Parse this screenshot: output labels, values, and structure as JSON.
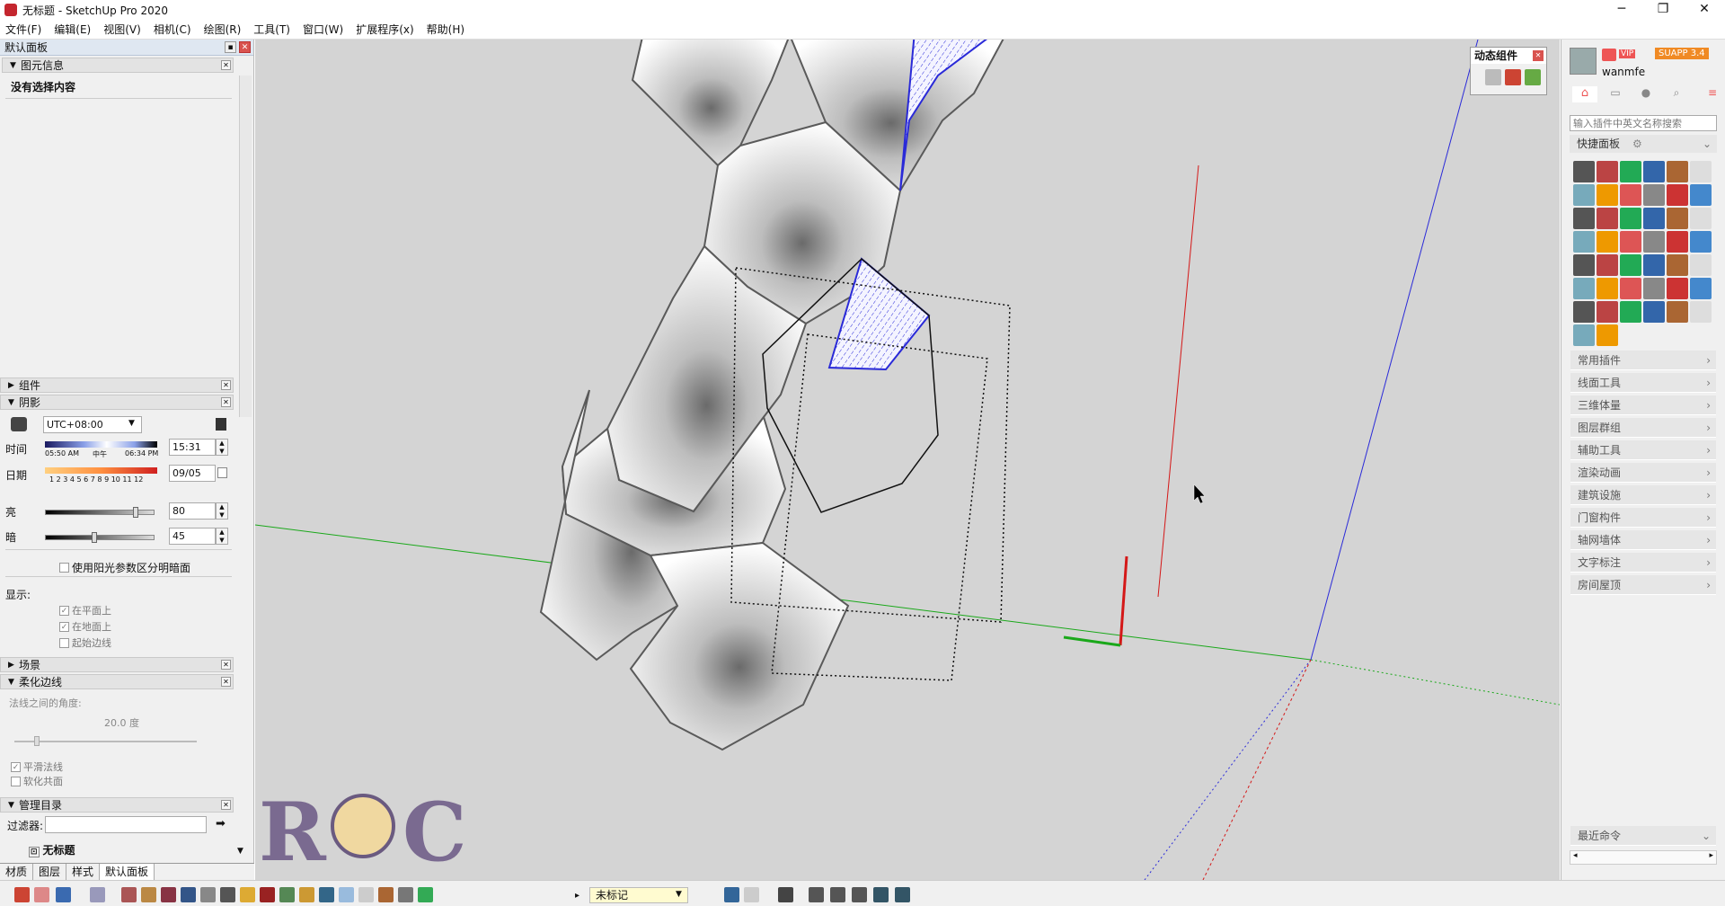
{
  "window": {
    "title": "无标题 - SketchUp Pro 2020",
    "minimize": "─",
    "maximize": "❐",
    "close": "✕"
  },
  "menu": [
    "文件(F)",
    "编辑(E)",
    "视图(V)",
    "相机(C)",
    "绘图(R)",
    "工具(T)",
    "窗口(W)",
    "扩展程序(x)",
    "帮助(H)"
  ],
  "tray": {
    "title": "默认面板"
  },
  "entity_info": {
    "title": "图元信息",
    "empty": "没有选择内容"
  },
  "components": {
    "title": "组件"
  },
  "shadows": {
    "title": "阴影",
    "timezone": "UTC+08:00",
    "time_label": "时间",
    "sunrise": "05:50 AM",
    "noon": "中午",
    "sunset": "06:34 PM",
    "time_value": "15:31",
    "date_label": "日期",
    "months": "1 2 3 4 5 6 7 8 9 10 11 12",
    "date_value": "09/05",
    "light_label": "亮",
    "light_value": "80",
    "dark_label": "暗",
    "dark_value": "45",
    "use_sun": "使用阳光参数区分明暗面",
    "display": "显示:",
    "on_faces": "在平面上",
    "on_ground": "在地面上",
    "from_edges": "起始边线",
    "on_faces_value": 0.8,
    "dark_slider_value": 0.45
  },
  "scenes": {
    "title": "场景"
  },
  "soften": {
    "title": "柔化边线",
    "angle_label": "法线之间的角度:",
    "angle_value": "20.0 度",
    "smooth": "平滑法线",
    "coplanar": "软化共面",
    "angle_fraction": 0.11
  },
  "outliner": {
    "title": "管理目录",
    "filter_label": "过滤器:",
    "root": "无标题"
  },
  "tabs": [
    "材质",
    "图层",
    "样式",
    "默认面板"
  ],
  "dynamic": {
    "title": "动态组件"
  },
  "suapp": {
    "user": "wanmfe",
    "badge": "SUAPP 3.4",
    "vip": "VIP",
    "search": "输入插件中英文名称搜索",
    "quick": "快捷面板",
    "categories": [
      "常用插件",
      "线面工具",
      "三维体量",
      "图层群组",
      "辅助工具",
      "渲染动画",
      "建筑设施",
      "门窗构件",
      "轴网墙体",
      "文字标注",
      "房间屋顶"
    ],
    "recent": "最近命令"
  },
  "status": {
    "tag": "未标记"
  },
  "watermark": "ROC",
  "colors": {
    "red_axis": "#d41818",
    "green_axis": "#1aa81a",
    "blue_axis": "#2a2ad8",
    "selection": "#2a2ad8"
  }
}
